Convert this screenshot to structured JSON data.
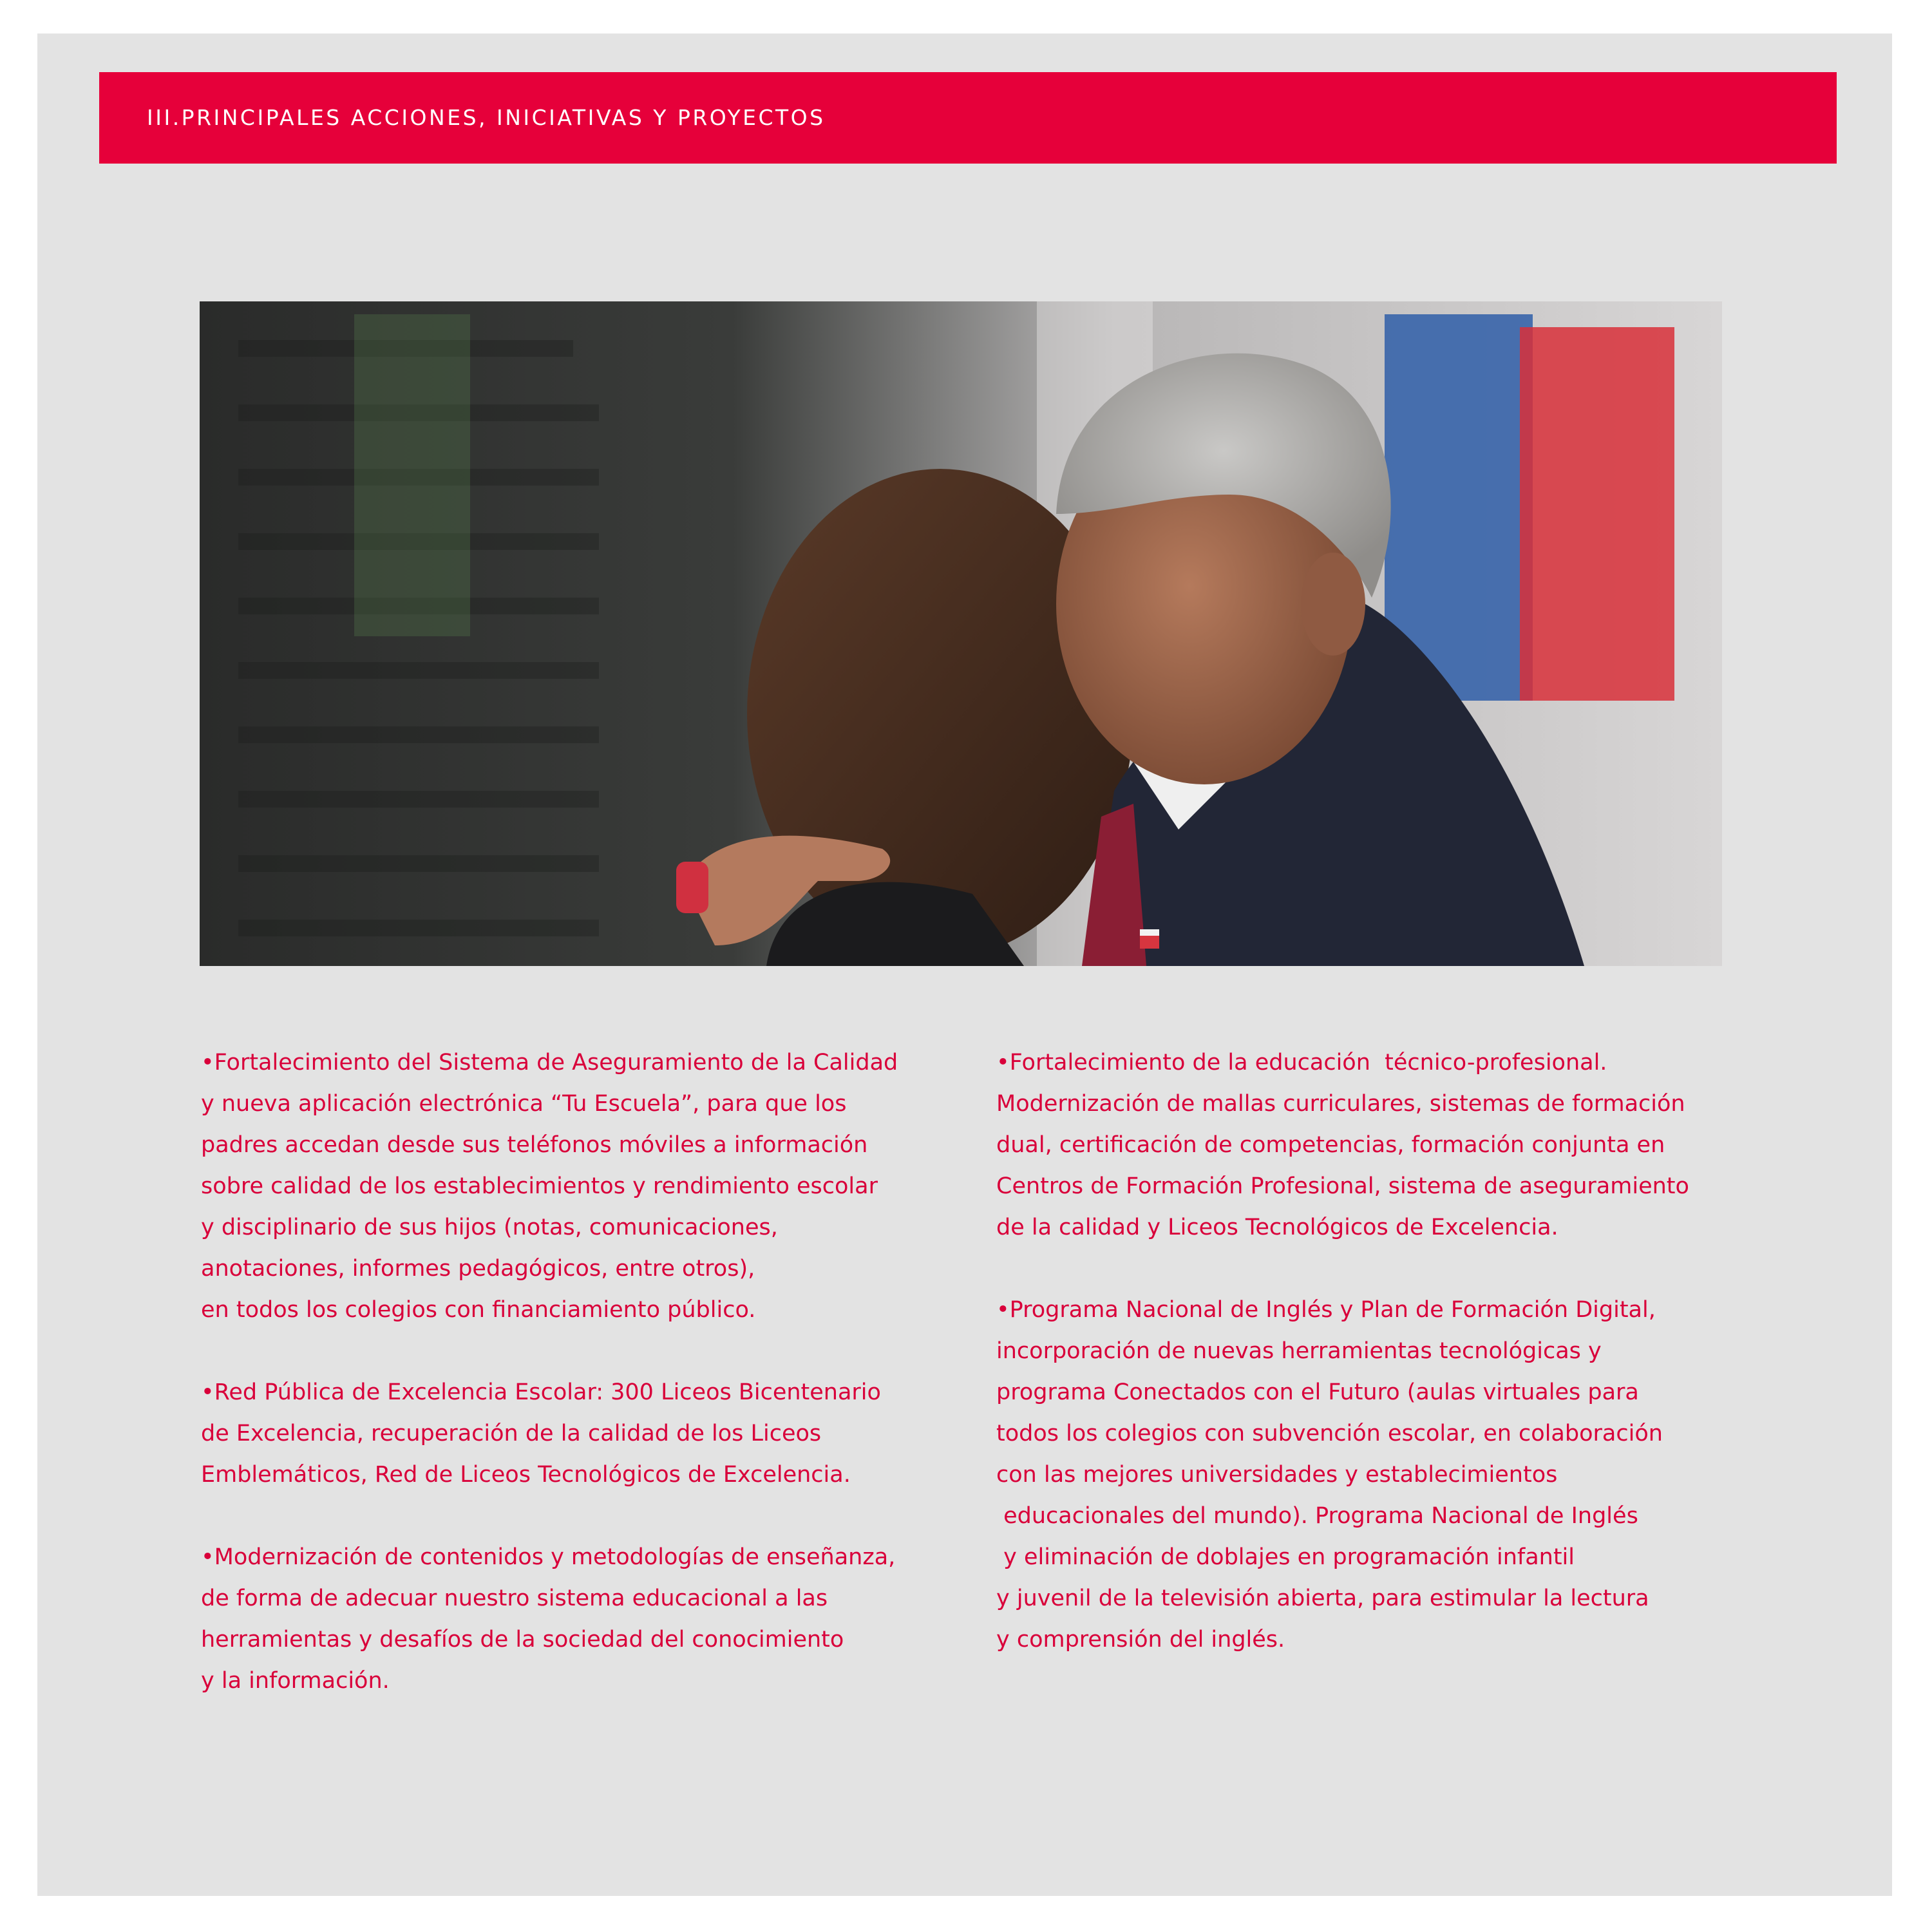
{
  "header": {
    "title": "III.PRINCIPALES ACCIONES, INICIATIVAS Y PROYECTOS"
  },
  "photo": {
    "alt": "Photo"
  },
  "left_column": [
    {
      "lines": [
        "•Fortalecimiento del Sistema de Aseguramiento de la Calidad",
        "y nueva aplicación electrónica “Tu Escuela”, para que los",
        "padres accedan desde sus teléfonos móviles a información",
        "sobre calidad de los establecimientos y rendimiento escolar",
        "y disciplinario de sus hijos (notas, comunicaciones,",
        "anotaciones, informes pedagógicos, entre otros),",
        "en todos los colegios con financiamiento público."
      ]
    },
    {
      "lines": [
        "•Red Pública de Excelencia Escolar: 300 Liceos Bicentenario",
        "de Excelencia, recuperación de la calidad de los Liceos",
        "Emblemáticos, Red de Liceos Tecnológicos de Excelencia."
      ]
    },
    {
      "lines": [
        "•Modernización de contenidos y metodologías de enseñanza,",
        "de forma de adecuar nuestro sistema educacional a las",
        "herramientas y desafíos de la sociedad del conocimiento",
        "y la información."
      ]
    }
  ],
  "right_column": [
    {
      "lines": [
        "•Fortalecimiento de la educación  técnico-profesional.",
        "Modernización de mallas curriculares, sistemas de formación",
        "dual, certificación de competencias, formación conjunta en",
        "Centros de Formación Profesional, sistema de aseguramiento",
        "de la calidad y Liceos Tecnológicos de Excelencia."
      ]
    },
    {
      "lines": [
        "•Programa Nacional de Inglés y Plan de Formación Digital,",
        "incorporación de nuevas herramientas tecnológicas y",
        "programa Conectados con el Futuro (aulas virtuales para",
        "todos los colegios con subvención escolar, en colaboración",
        "con las mejores universidades y establecimientos",
        " educacionales del mundo). Programa Nacional de Inglés",
        " y eliminación de doblajes en programación infantil",
        "y juvenil de la televisión abierta, para estimular la lectura",
        "y comprensión del inglés."
      ]
    }
  ],
  "colors": {
    "accent": "#e6003a",
    "text": "#d9003a",
    "page_background": "#e3e3e3"
  }
}
